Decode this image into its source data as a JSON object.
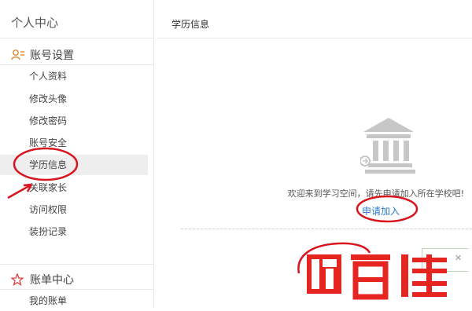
{
  "sidebar": {
    "title": "个人中心",
    "groups": [
      {
        "label": "账号设置",
        "icon": "user-card-icon",
        "items": [
          {
            "label": "个人资料"
          },
          {
            "label": "修改头像"
          },
          {
            "label": "修改密码"
          },
          {
            "label": "账号安全"
          },
          {
            "label": "学历信息",
            "active": true
          },
          {
            "label": "关联家长"
          },
          {
            "label": "访问权限"
          },
          {
            "label": "装扮记录"
          }
        ]
      },
      {
        "label": "账单中心",
        "icon": "star-icon",
        "items": [
          {
            "label": "我的账单"
          }
        ]
      }
    ]
  },
  "main": {
    "title": "学历信息",
    "icon": "bank-building-icon",
    "welcome_text": "欢迎来到学习空间，请先申请加入所在学校吧!",
    "join_link": "申请加入"
  },
  "watermark": {
    "icon": "brand-logo",
    "text": "百佳"
  },
  "colors": {
    "link": "#2b7bd0",
    "annotation": "#d8141e",
    "icon_gray": "#c7c7c7"
  }
}
